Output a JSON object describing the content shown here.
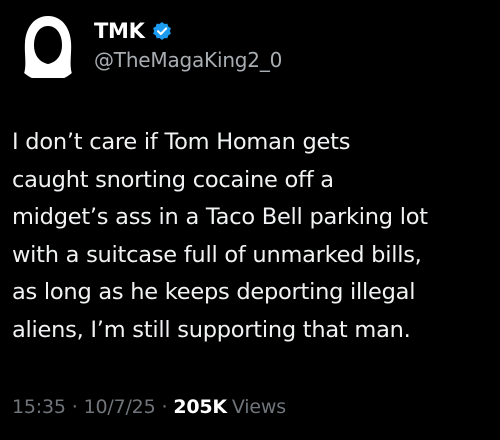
{
  "author": {
    "display_name": "TMK",
    "handle": "@TheMagaKing2_0",
    "verified": true,
    "avatar_icon": "hooded-figure-icon"
  },
  "tweet": {
    "lines": [
      "I don’t care if Tom Homan gets",
      "caught snorting cocaine off a",
      "midget’s ass in a Taco Bell parking lot",
      "with a suitcase full of unmarked bills,",
      "as long as he keeps deporting illegal",
      "aliens, I’m still supporting that man."
    ]
  },
  "meta": {
    "time": "15:35",
    "date": "10/7/25",
    "separator": "·",
    "views_count": "205K",
    "views_label": "Views"
  },
  "colors": {
    "background": "#000000",
    "text": "#e7e9ea",
    "secondary": "#6f757a",
    "verified_badge": "#1d9bf0"
  }
}
